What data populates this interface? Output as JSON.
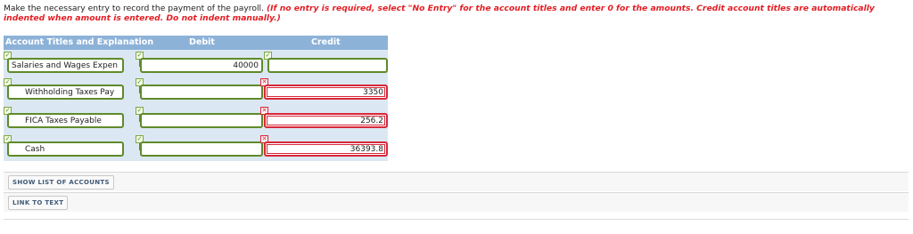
{
  "instructions": {
    "main": "Make the necessary entry to record the payment of the payroll. ",
    "note": "(If no entry is required, select \"No Entry\" for the account titles and enter 0 for the amounts. Credit account titles are automatically indented when amount is entered. Do not indent manually.)"
  },
  "table": {
    "headers": {
      "account": "Account Titles and Explanation",
      "debit": "Debit",
      "credit": "Credit"
    },
    "rows": [
      {
        "account": "Salaries and Wages Expen",
        "debit": "40000",
        "credit": "",
        "account_status": "correct",
        "debit_status": "correct",
        "credit_status": "correct"
      },
      {
        "account": "Withholding Taxes Pay",
        "debit": "",
        "credit": "3350",
        "account_status": "correct",
        "debit_status": "correct",
        "credit_status": "incorrect"
      },
      {
        "account": "FICA Taxes Payable",
        "debit": "",
        "credit": "256.2",
        "account_status": "correct",
        "debit_status": "correct",
        "credit_status": "incorrect"
      },
      {
        "account": "Cash",
        "debit": "",
        "credit": "36393.8",
        "account_status": "correct",
        "debit_status": "correct",
        "credit_status": "incorrect"
      }
    ]
  },
  "buttons": {
    "show_accounts": "SHOW LIST OF ACCOUNTS",
    "link_to_text": "LINK TO TEXT"
  },
  "colors": {
    "header_bg": "#8db2d8",
    "table_bg": "#dbe8f3",
    "correct": "#5f8a2a",
    "incorrect": "#d8283a",
    "instruction_note": "#e31e24"
  },
  "icons": {
    "correct": "check-icon",
    "incorrect": "x-icon"
  }
}
